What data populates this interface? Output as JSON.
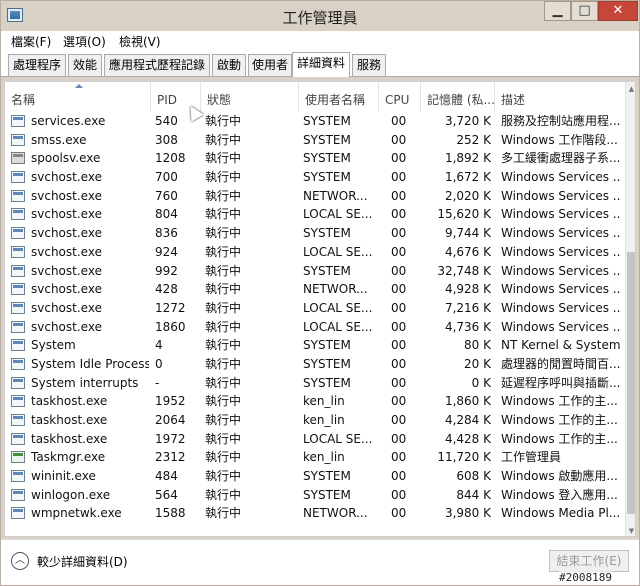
{
  "window": {
    "title": "工作管理員"
  },
  "titlebar": {
    "min": "▁",
    "max": "□",
    "close": "✕"
  },
  "menu": [
    "檔案(F)",
    "選項(O)",
    "檢視(V)"
  ],
  "tabs": [
    "處理程序",
    "效能",
    "應用程式歷程記錄",
    "啟動",
    "使用者",
    "詳細資料",
    "服務"
  ],
  "active_tab": "詳細資料",
  "columns": [
    "名稱",
    "PID",
    "狀態",
    "使用者名稱",
    "CPU",
    "記憶體 (私...",
    "描述"
  ],
  "rows": [
    {
      "name": "services.exe",
      "pid": "540",
      "status": "執行中",
      "user": "SYSTEM",
      "cpu": "00",
      "mem": "3,720 K",
      "desc": "服務及控制站應用程...",
      "icon": "process-icon"
    },
    {
      "name": "smss.exe",
      "pid": "308",
      "status": "執行中",
      "user": "SYSTEM",
      "cpu": "00",
      "mem": "252 K",
      "desc": "Windows 工作階段...",
      "icon": "process-icon"
    },
    {
      "name": "spoolsv.exe",
      "pid": "1208",
      "status": "執行中",
      "user": "SYSTEM",
      "cpu": "00",
      "mem": "1,892 K",
      "desc": "多工緩衝處理器子系...",
      "icon": "printer-icon"
    },
    {
      "name": "svchost.exe",
      "pid": "700",
      "status": "執行中",
      "user": "SYSTEM",
      "cpu": "00",
      "mem": "1,672 K",
      "desc": "Windows Services ...",
      "icon": "process-icon"
    },
    {
      "name": "svchost.exe",
      "pid": "760",
      "status": "執行中",
      "user": "NETWOR...",
      "cpu": "00",
      "mem": "2,020 K",
      "desc": "Windows Services ...",
      "icon": "process-icon"
    },
    {
      "name": "svchost.exe",
      "pid": "804",
      "status": "執行中",
      "user": "LOCAL SE...",
      "cpu": "00",
      "mem": "15,620 K",
      "desc": "Windows Services ...",
      "icon": "process-icon"
    },
    {
      "name": "svchost.exe",
      "pid": "836",
      "status": "執行中",
      "user": "SYSTEM",
      "cpu": "00",
      "mem": "9,744 K",
      "desc": "Windows Services ...",
      "icon": "process-icon"
    },
    {
      "name": "svchost.exe",
      "pid": "924",
      "status": "執行中",
      "user": "LOCAL SE...",
      "cpu": "00",
      "mem": "4,676 K",
      "desc": "Windows Services ...",
      "icon": "process-icon"
    },
    {
      "name": "svchost.exe",
      "pid": "992",
      "status": "執行中",
      "user": "SYSTEM",
      "cpu": "00",
      "mem": "32,748 K",
      "desc": "Windows Services ...",
      "icon": "process-icon"
    },
    {
      "name": "svchost.exe",
      "pid": "428",
      "status": "執行中",
      "user": "NETWOR...",
      "cpu": "00",
      "mem": "4,928 K",
      "desc": "Windows Services ...",
      "icon": "process-icon"
    },
    {
      "name": "svchost.exe",
      "pid": "1272",
      "status": "執行中",
      "user": "LOCAL SE...",
      "cpu": "00",
      "mem": "7,216 K",
      "desc": "Windows Services ...",
      "icon": "process-icon"
    },
    {
      "name": "svchost.exe",
      "pid": "1860",
      "status": "執行中",
      "user": "LOCAL SE...",
      "cpu": "00",
      "mem": "4,736 K",
      "desc": "Windows Services ...",
      "icon": "process-icon"
    },
    {
      "name": "System",
      "pid": "4",
      "status": "執行中",
      "user": "SYSTEM",
      "cpu": "00",
      "mem": "80 K",
      "desc": "NT Kernel & System",
      "icon": "process-icon"
    },
    {
      "name": "System Idle Process",
      "pid": "0",
      "status": "執行中",
      "user": "SYSTEM",
      "cpu": "00",
      "mem": "20 K",
      "desc": "處理器的閒置時間百...",
      "icon": "process-icon"
    },
    {
      "name": "System interrupts",
      "pid": "-",
      "status": "執行中",
      "user": "SYSTEM",
      "cpu": "00",
      "mem": "0 K",
      "desc": "延遲程序呼叫與插斷...",
      "icon": "process-icon"
    },
    {
      "name": "taskhost.exe",
      "pid": "1952",
      "status": "執行中",
      "user": "ken_lin",
      "cpu": "00",
      "mem": "1,860 K",
      "desc": "Windows 工作的主...",
      "icon": "process-icon"
    },
    {
      "name": "taskhost.exe",
      "pid": "2064",
      "status": "執行中",
      "user": "ken_lin",
      "cpu": "00",
      "mem": "4,284 K",
      "desc": "Windows 工作的主...",
      "icon": "process-icon"
    },
    {
      "name": "taskhost.exe",
      "pid": "1972",
      "status": "執行中",
      "user": "LOCAL SE...",
      "cpu": "00",
      "mem": "4,428 K",
      "desc": "Windows 工作的主...",
      "icon": "process-icon"
    },
    {
      "name": "Taskmgr.exe",
      "pid": "2312",
      "status": "執行中",
      "user": "ken_lin",
      "cpu": "00",
      "mem": "11,720 K",
      "desc": "工作管理員",
      "icon": "chart-icon"
    },
    {
      "name": "wininit.exe",
      "pid": "484",
      "status": "執行中",
      "user": "SYSTEM",
      "cpu": "00",
      "mem": "608 K",
      "desc": "Windows 啟動應用...",
      "icon": "process-icon"
    },
    {
      "name": "winlogon.exe",
      "pid": "564",
      "status": "執行中",
      "user": "SYSTEM",
      "cpu": "00",
      "mem": "844 K",
      "desc": "Windows 登入應用...",
      "icon": "process-icon"
    },
    {
      "name": "wmpnetwk.exe",
      "pid": "1588",
      "status": "執行中",
      "user": "NETWOR...",
      "cpu": "00",
      "mem": "3,980 K",
      "desc": "Windows Media Pl...",
      "icon": "process-icon"
    }
  ],
  "footer": {
    "fewer_details": "較少詳細資料(D)",
    "end_task": "結束工作(E)"
  },
  "watermark": "#2008189"
}
